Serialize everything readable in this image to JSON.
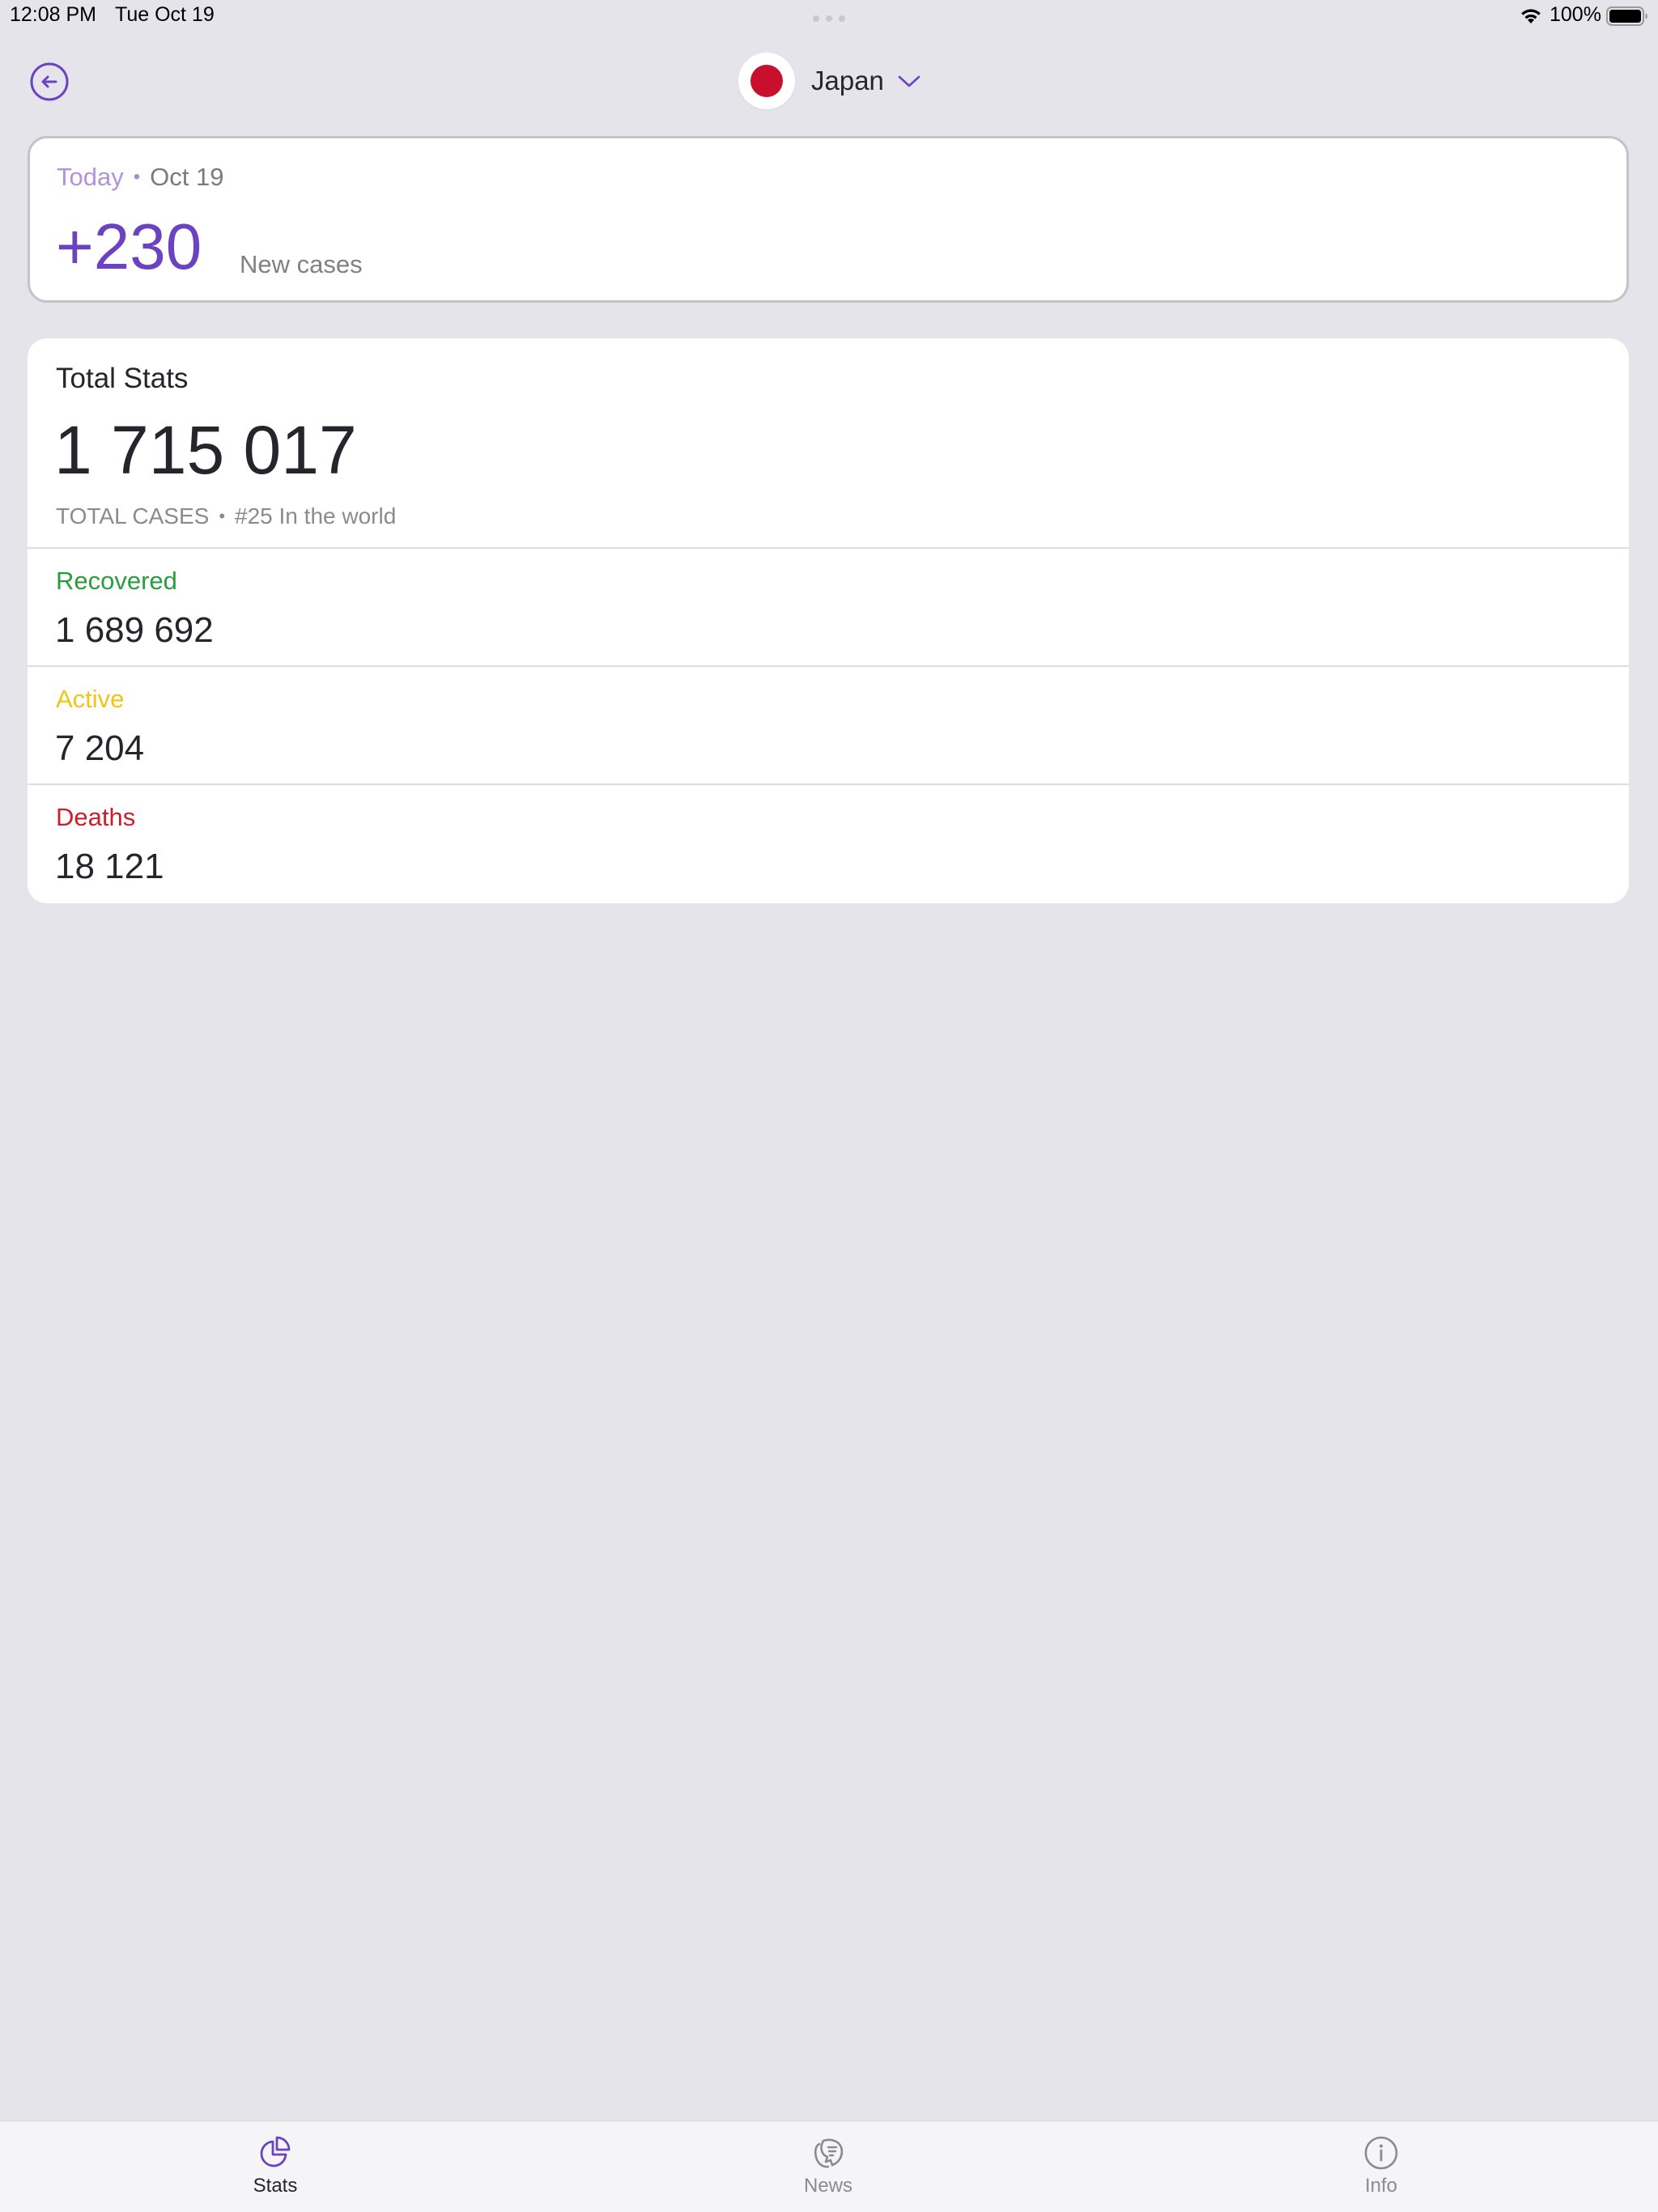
{
  "status_bar": {
    "time": "12:08 PM",
    "date": "Tue Oct 19",
    "battery": "100%"
  },
  "header": {
    "country": "Japan",
    "flag_color": "#c8102e",
    "accent": "#6a43c2"
  },
  "today": {
    "label": "Today",
    "separator": "•",
    "date": "Oct 19",
    "value": "+230",
    "caption": "New cases"
  },
  "total_stats": {
    "title": "Total Stats",
    "total": "1 715 017",
    "total_label": "TOTAL CASES",
    "separator": "•",
    "rank_text": "#25 In the world",
    "rows": [
      {
        "label": "Recovered",
        "value": "1 689 692",
        "color": "#2a9d3c"
      },
      {
        "label": "Active",
        "value": "7 204",
        "color": "#f0c419"
      },
      {
        "label": "Deaths",
        "value": "18 121",
        "color": "#cc1f2d"
      }
    ]
  },
  "tabs": [
    {
      "label": "Stats",
      "icon": "pie-chart-icon",
      "active": true
    },
    {
      "label": "News",
      "icon": "news-icon",
      "active": false
    },
    {
      "label": "Info",
      "icon": "info-icon",
      "active": false
    }
  ]
}
